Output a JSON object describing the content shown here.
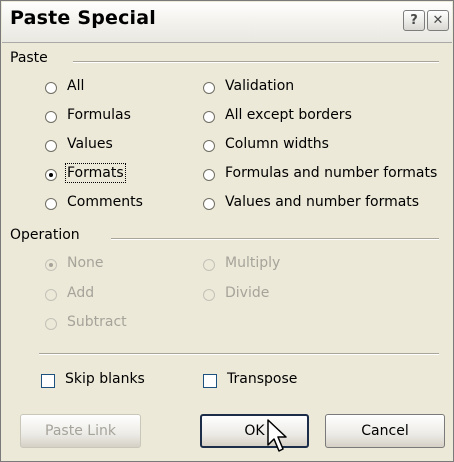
{
  "dialog": {
    "title": "Paste Special",
    "help_icon": "?",
    "close_icon": "✕"
  },
  "paste": {
    "group_label": "Paste",
    "options": [
      {
        "label": "All",
        "selected": false
      },
      {
        "label": "Formulas",
        "selected": false
      },
      {
        "label": "Values",
        "selected": false
      },
      {
        "label": "Formats",
        "selected": true
      },
      {
        "label": "Comments",
        "selected": false
      },
      {
        "label": "Validation",
        "selected": false
      },
      {
        "label": "All except borders",
        "selected": false
      },
      {
        "label": "Column widths",
        "selected": false
      },
      {
        "label": "Formulas and number formats",
        "selected": false
      },
      {
        "label": "Values and number formats",
        "selected": false
      }
    ]
  },
  "operation": {
    "group_label": "Operation",
    "options": [
      {
        "label": "None",
        "selected": true
      },
      {
        "label": "Add",
        "selected": false
      },
      {
        "label": "Subtract",
        "selected": false
      },
      {
        "label": "Multiply",
        "selected": false
      },
      {
        "label": "Divide",
        "selected": false
      }
    ]
  },
  "checkboxes": {
    "skip_blanks": {
      "label": "Skip blanks",
      "checked": false
    },
    "transpose": {
      "label": "Transpose",
      "checked": false
    }
  },
  "buttons": {
    "paste_link": "Paste Link",
    "ok": "OK",
    "cancel": "Cancel"
  }
}
